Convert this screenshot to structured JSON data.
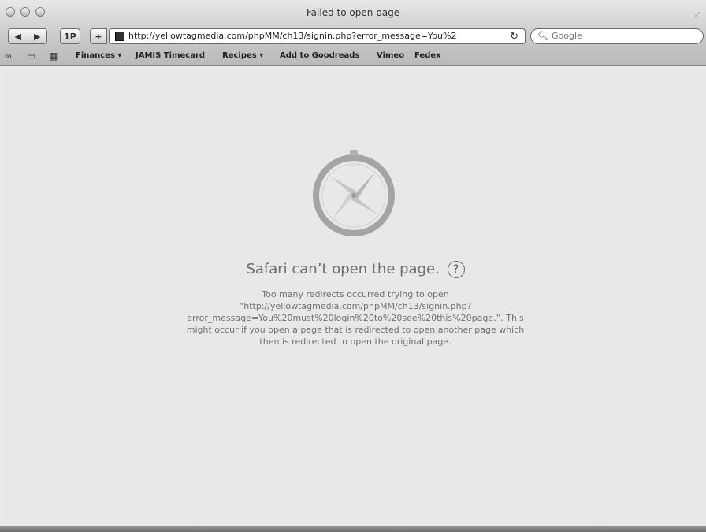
{
  "window": {
    "title": "Failed to open page"
  },
  "toolbar": {
    "back_label": "◀",
    "forward_label": "▶",
    "onepassword_label": "1P",
    "add_label": "+",
    "url": "http://yellowtagmedia.com/phpMM/ch13/signin.php?error_message=You%2",
    "search_placeholder": "Google"
  },
  "bookmarks": {
    "items": [
      {
        "label": "Finances ▾"
      },
      {
        "label": "JAMIS Timecard"
      },
      {
        "label": "Recipes ▾"
      },
      {
        "label": "Add to Goodreads"
      },
      {
        "label": "Vimeo"
      },
      {
        "label": "Fedex"
      }
    ]
  },
  "error": {
    "title": "Safari can’t open the page.",
    "help_label": "?",
    "message_lines": [
      "Too many redirects occurred trying to open",
      "“http://yellowtagmedia.com/phpMM/ch13/signin.php?",
      "error_message=You%20must%20login%20to%20see%20this%20page.”. This",
      "might occur if you open a page that is redirected to open another page which",
      "then is redirected to open the original page."
    ]
  },
  "colors": {
    "content_bg": "#e8e8e8",
    "text_gray": "#707070",
    "accent_compass": "#9a9a9a"
  }
}
